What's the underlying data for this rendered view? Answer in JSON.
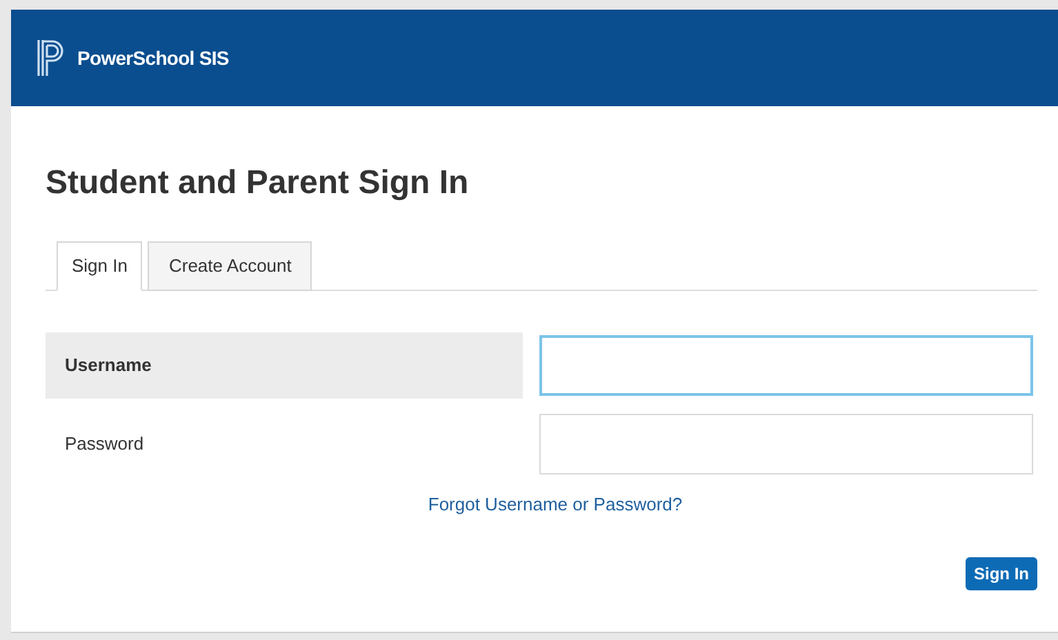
{
  "header": {
    "brand": "PowerSchool SIS"
  },
  "title": "Student and Parent Sign In",
  "tabs": [
    {
      "label": "Sign In",
      "selected": true
    },
    {
      "label": "Create Account",
      "selected": false
    }
  ],
  "fields": [
    {
      "label": "Username",
      "focused": true
    },
    {
      "label": "Password",
      "focused": false
    }
  ],
  "forgot_link": "Forgot Username or Password?",
  "submit_button": "Sign In"
}
